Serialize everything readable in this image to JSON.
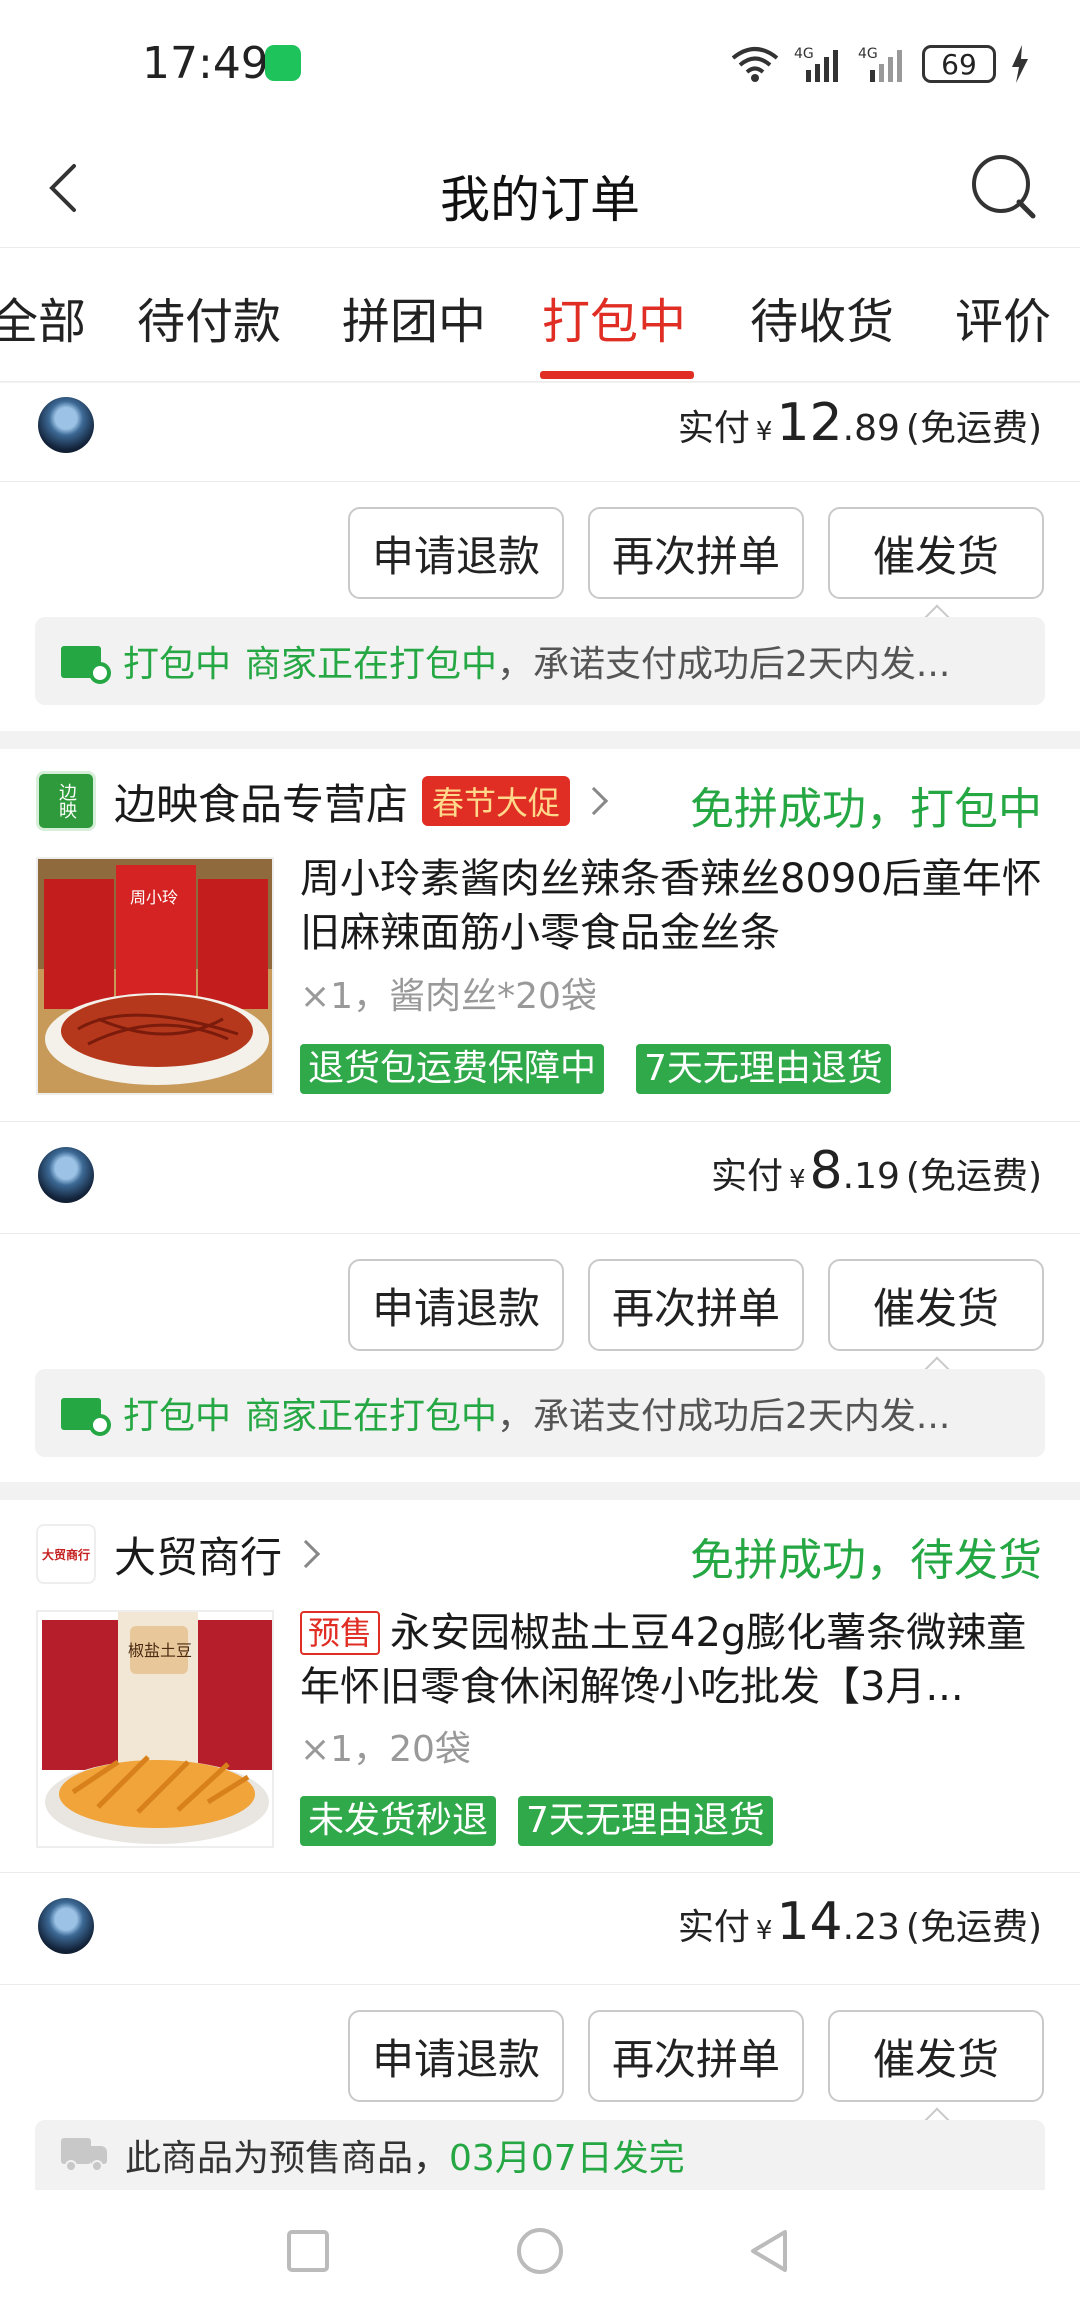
{
  "status_bar": {
    "time": "17:49",
    "battery": "69"
  },
  "header": {
    "title": "我的订单"
  },
  "tabs": [
    {
      "label": "全部"
    },
    {
      "label": "待付款"
    },
    {
      "label": "拼团中"
    },
    {
      "label": "打包中",
      "active": true
    },
    {
      "label": "待收货"
    },
    {
      "label": "评价"
    }
  ],
  "orders": [
    {
      "pay_label": "实付",
      "currency": "¥",
      "price_int": "12",
      "price_dec": ".89",
      "shipping": "(免运费)",
      "notice": {
        "state": "打包中",
        "merchant": "商家正在打包中",
        "rest": "，承诺支付成功后2天内发..."
      }
    },
    {
      "shop": "边映食品专营店",
      "shop_logo_text": "边映",
      "promo": "春节大促",
      "status": "免拼成功，打包中",
      "title": "周小玲素酱肉丝辣条香辣丝8090后童年怀旧麻辣面筋小零食品金丝条",
      "spec": "×1，酱肉丝*20袋",
      "thumb_text": "周小玲",
      "tags": [
        "退货包运费保障中",
        "7天无理由退货"
      ],
      "pay_label": "实付",
      "currency": "¥",
      "price_int": "8",
      "price_dec": ".19",
      "shipping": "(免运费)",
      "notice": {
        "state": "打包中",
        "merchant": "商家正在打包中",
        "rest": "，承诺支付成功后2天内发..."
      }
    },
    {
      "shop": "大贸商行",
      "shop_logo_text": "大贸商行",
      "status": "免拼成功，待发货",
      "presale": "预售",
      "title": "永安园椒盐土豆42g膨化薯条微辣童年怀旧零食休闲解馋小吃批发【3月...",
      "spec": "×1，20袋",
      "thumb_text": "椒盐土豆",
      "tags": [
        "未发货秒退",
        "7天无理由退货"
      ],
      "pay_label": "实付",
      "currency": "¥",
      "price_int": "14",
      "price_dec": ".23",
      "shipping": "(免运费)",
      "notice": {
        "prefix": "此商品为预售商品，",
        "date": "03月07日发完"
      }
    }
  ],
  "actions": {
    "refund": "申请退款",
    "regroup": "再次拼单",
    "urge": "催发货"
  },
  "colors": {
    "accent": "#e02e24",
    "success": "#25a743",
    "tag_bg": "#2fa94a"
  },
  "icons": [
    "back-arrow-icon",
    "search-icon",
    "package-icon",
    "truck-icon",
    "chevron-right-icon",
    "square-nav-icon",
    "circle-nav-icon",
    "triangle-nav-icon"
  ]
}
